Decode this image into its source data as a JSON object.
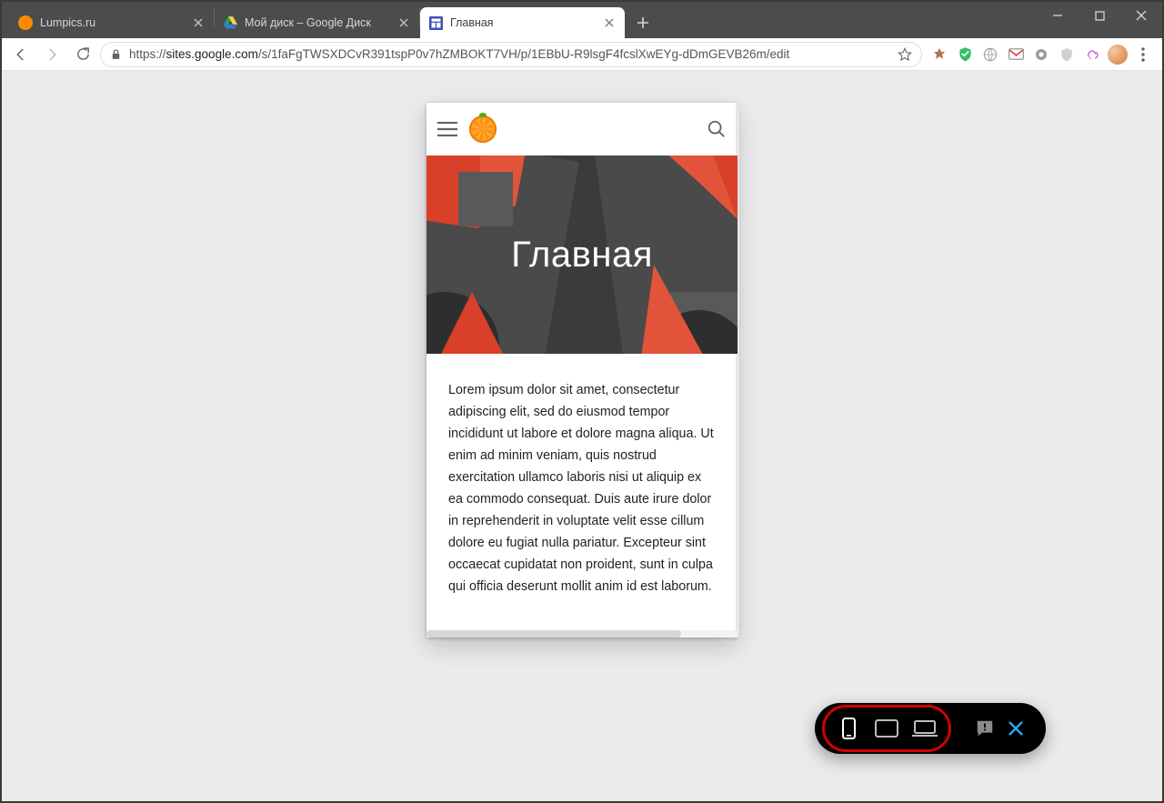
{
  "window": {
    "tabs": [
      {
        "label": "Lumpics.ru",
        "icon": "orange-dot",
        "active": false
      },
      {
        "label": "Мой диск – Google Диск",
        "icon": "gdrive",
        "active": false
      },
      {
        "label": "Главная",
        "icon": "gsites",
        "active": true
      }
    ]
  },
  "addressbar": {
    "scheme": "https://",
    "host": "sites.google.com",
    "path": "/s/1faFgTWSXDCvR391tspP0v7hZMBOKT7VH/p/1EBbU-R9lsgF4fcslXwEYg-dDmGEVB26m/edit"
  },
  "preview": {
    "hero_title": "Главная",
    "body": "Lorem ipsum dolor sit amet, consectetur adipiscing elit, sed do eiusmod tempor incididunt ut labore et dolore magna aliqua. Ut enim ad minim veniam, quis nostrud exercitation ullamco laboris nisi ut aliquip ex ea commodo consequat. Duis aute irure dolor in reprehenderit in voluptate velit esse cillum dolore eu fugiat nulla pariatur. Excepteur sint occaecat cupidatat non proident, sunt in culpa qui officia deserunt mollit anim id est laborum."
  },
  "device_switcher": {
    "phone_selected": true
  },
  "colors": {
    "accent_red": "#d40000",
    "close_blue": "#2aa3ef"
  }
}
